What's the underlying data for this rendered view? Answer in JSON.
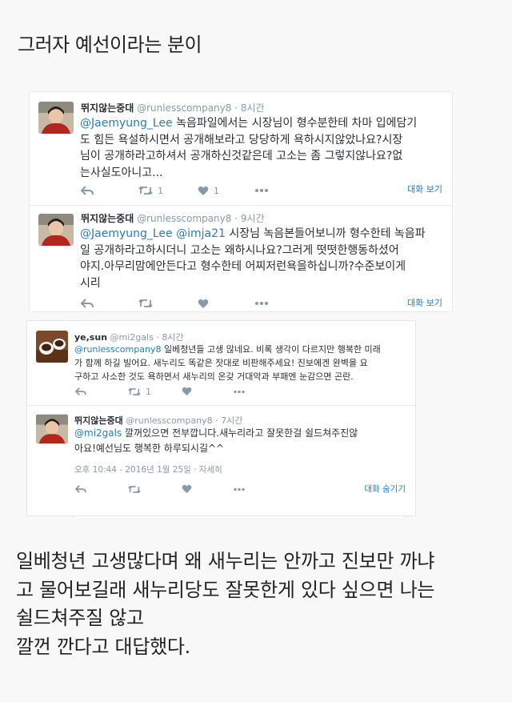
{
  "heading": "그러자 예선이라는 분이",
  "thread_tweets": [
    {
      "name": "뛰지않는중대",
      "handle": "@runlesscompany8",
      "sep": "·",
      "time": "8시간",
      "lines": [
        {
          "mention": "@Jaemyung_Lee",
          "text": " 녹음파일에서는 시장님이 형수분한테 차마 입에담기"
        },
        {
          "text": "도 힘든 욕설하시면서 공개해보라고 당당하게 욕하시지않았나요?시장"
        },
        {
          "text": "님이 공개하라고하셔서 공개하신것같은데 고소는 좀 그렇지않나요?없"
        },
        {
          "text": "는사실도아니고..."
        }
      ],
      "retweets": "1",
      "likes": "1",
      "conversation": "대화 보기"
    },
    {
      "name": "뛰지않는중대",
      "handle": "@runlesscompany8",
      "sep": "·",
      "time": "9시간",
      "lines": [
        {
          "mention": "@Jaemyung_Lee",
          "mid": " ",
          "mention2": "@imja21",
          "text": " 시장님 녹음본들어보니까 형수한테 녹음파"
        },
        {
          "text": "일 공개하라고하시더니 고소는 왜하시나요?그러게 떳떳한행동하셨어"
        },
        {
          "text": "야지.아무리맘에안든다고 형수한테 어찌저런욕을하십니까?수준보이게"
        },
        {
          "text": "시리"
        }
      ],
      "retweets": "",
      "likes": "",
      "conversation": "대화 보기"
    }
  ],
  "reply_tweets": [
    {
      "name": "ye,sun",
      "handle": "@mi2gals",
      "sep": "·",
      "time": "8시간",
      "lines": [
        {
          "mention": "@runlesscompany8",
          "text": " 일베청년들 고생 많네요. 비록 생각이 다르지만 행복한 미래"
        },
        {
          "text": "가 함께 하길 빌어요. 새누리도 똑같은 잣대로 비판해주세요! 진보에겐 완벽을 요"
        },
        {
          "text": "구하고 사소한 것도 욕하면서 새누리의 온갖 거대악과 부패엔 눈감으면 곤란."
        }
      ],
      "retweets": "1",
      "likes": ""
    },
    {
      "name": "뛰지않는중대",
      "handle": "@runlesscompany8",
      "sep": "·",
      "time": "7시간",
      "lines": [
        {
          "mention": "@mi2gals",
          "text": " 깔꺼있으면 전부깝니다.새누리라고 잘못한걸 쉴드쳐주진않"
        },
        {
          "text": "아요!예선님도 행복한 하루되시길^^"
        }
      ],
      "timestamp": "오후 10:44 - 2016년 1월 25일 · 자세히",
      "retweets": "",
      "likes": "",
      "conversation": "대화 숨기기"
    }
  ],
  "bottom_lines": [
    "일베청년 고생많다며 왜 새누리는 안까고 진보만 까냐",
    "고 물어보길래 새누리당도 잘못한게 있다 싶으면 나는",
    "쉴드쳐주질 않고",
    "깔껀 깐다고 대답했다."
  ],
  "icons": [
    "reply-icon",
    "retweet-icon",
    "heart-icon",
    "more-icon"
  ],
  "colors": {
    "link": "#2b7bb9",
    "muted": "#8899a6",
    "text": "#292f33",
    "border": "#e6ecf0"
  }
}
